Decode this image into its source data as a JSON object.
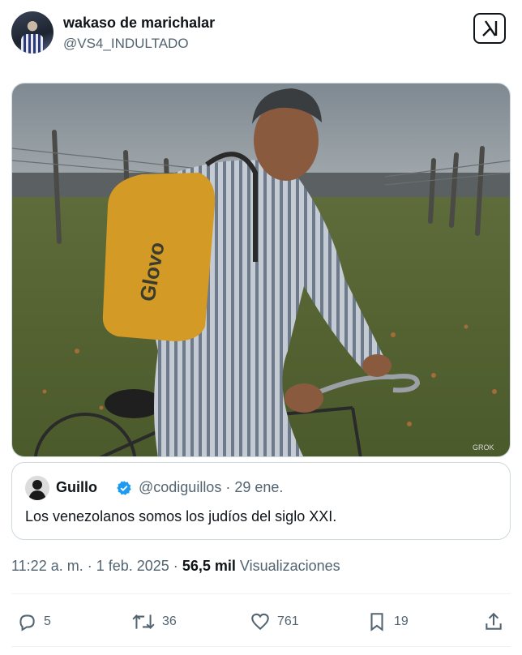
{
  "author": {
    "name": "wakaso de marichalar",
    "handle": "@VS4_INDULTADO"
  },
  "media": {
    "bag_brand": "Glovo",
    "watermark": "GROK"
  },
  "quote": {
    "name": "Guillo",
    "handle": "@codiguillos",
    "date": "· 29 ene.",
    "text": "Los venezolanos somos los judíos del siglo XXI."
  },
  "meta": {
    "time": "11:22 a. m.",
    "date": "· 1 feb. 2025 ·",
    "views_count": "56,5 mil",
    "views_label": "Visualizaciones"
  },
  "actions": {
    "replies": "5",
    "reposts": "36",
    "likes": "761",
    "bookmarks": "19"
  },
  "colors": {
    "text": "#0f1419",
    "secondary": "#536471",
    "verified": "#1d9bf0",
    "border": "#cfd9de"
  },
  "icons": [
    "grok-icon",
    "verified-icon",
    "reply-icon",
    "repost-icon",
    "like-icon",
    "bookmark-icon",
    "share-icon"
  ]
}
